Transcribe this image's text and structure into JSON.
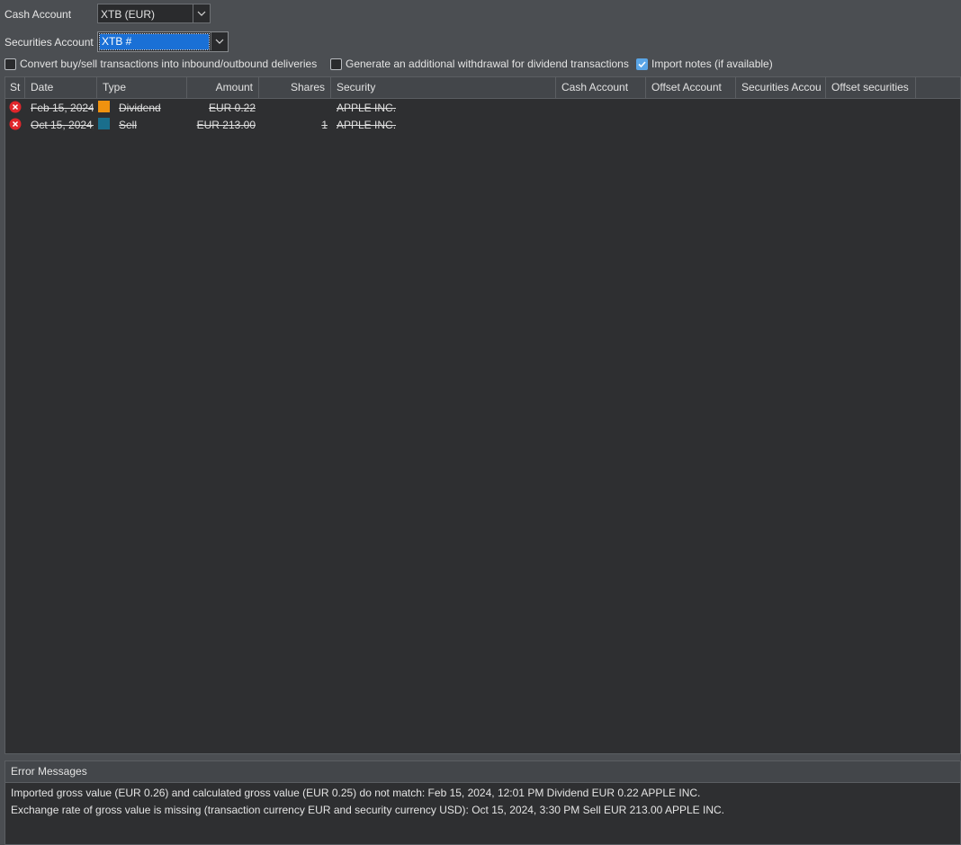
{
  "accounts": {
    "cash_label": "Cash Account",
    "cash_value": "XTB (EUR)",
    "securities_label": "Securities Account",
    "securities_value": "XTB #"
  },
  "options": [
    {
      "label": "Convert buy/sell transactions into inbound/outbound deliveries",
      "checked": false
    },
    {
      "label": "Generate an additional withdrawal for dividend transactions",
      "checked": false
    },
    {
      "label": "Import notes (if available)",
      "checked": true
    }
  ],
  "table": {
    "columns": [
      "St",
      "Date",
      "Type",
      "Amount",
      "Shares",
      "Security",
      "Cash Account",
      "Offset Account",
      "Securities Accou",
      "Offset securities"
    ],
    "rows": [
      {
        "status": "error",
        "date": "Feb 15, 2024,",
        "type": "Dividend",
        "type_color": "#f0920f",
        "amount": "EUR 0.22",
        "shares": "",
        "security": "APPLE INC."
      },
      {
        "status": "error",
        "date": "Oct 15, 2024,",
        "type": "Sell",
        "type_color": "#1a6e8c",
        "amount": "EUR 213.00",
        "shares": "1",
        "security": "APPLE INC."
      }
    ]
  },
  "errors": {
    "title": "Error Messages",
    "messages": [
      "Imported gross value (EUR 0.26) and calculated gross value (EUR 0.25) do not match: Feb 15, 2024, 12:01 PM Dividend EUR 0.22 APPLE INC.",
      "Exchange rate of gross value is missing (transaction currency EUR and security currency USD): Oct 15, 2024, 3:30 PM Sell EUR 213.00 APPLE INC."
    ]
  },
  "icons": {
    "status_error": "error-circle-icon",
    "dropdown": "chevron-down-icon",
    "checkmark": "checkmark-icon"
  },
  "colors": {
    "error_red": "#e0262b",
    "checkbox_accent": "#5aa5e6",
    "selection_blue": "#1a70d6"
  }
}
